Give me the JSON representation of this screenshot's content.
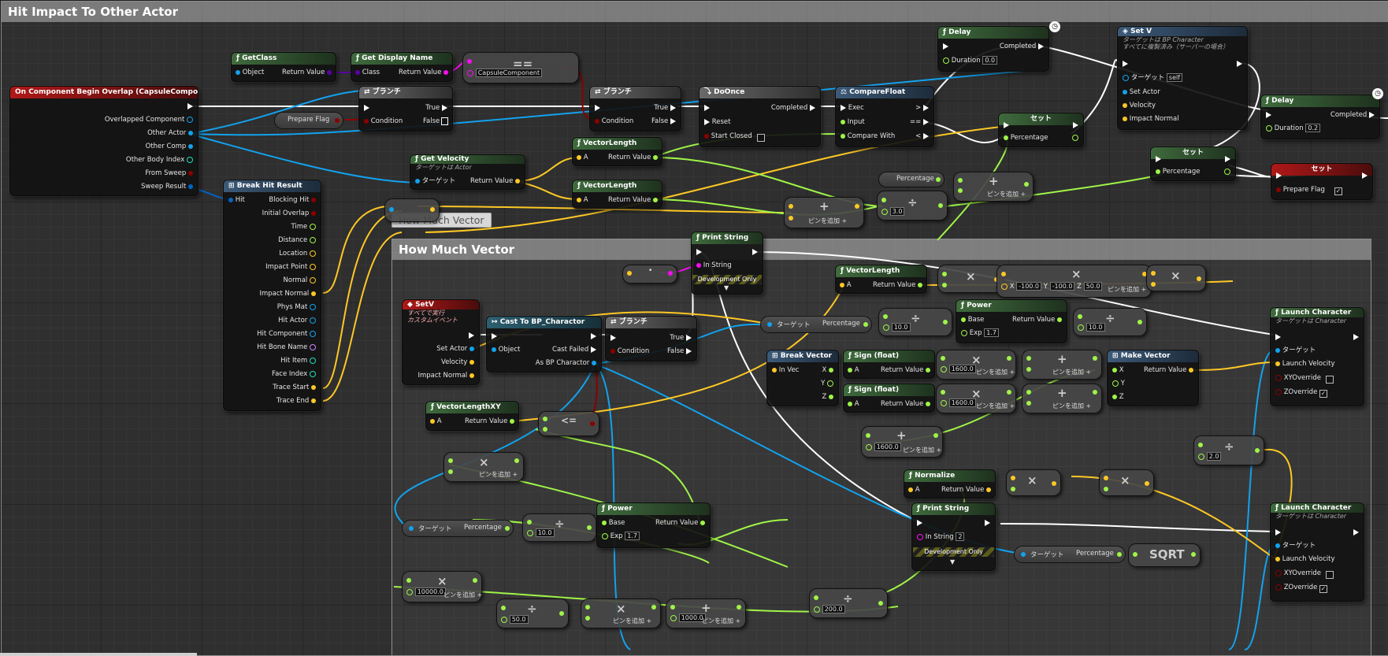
{
  "comment_main": "Hit Impact To Other Actor",
  "comment_sub": "How Much Vector",
  "comment_bubble": "How Much Vector",
  "event": {
    "title": "On Component Begin Overlap (CapsuleComponent)",
    "pins": [
      "Overlapped Component",
      "Other Actor",
      "Other Comp",
      "Other Body Index",
      "From Sweep",
      "Sweep Result"
    ]
  },
  "get_class": {
    "title": "GetClass",
    "in": "Object",
    "out": "Return Value"
  },
  "get_display_name": {
    "title": "Get Display Name",
    "in": "Class",
    "out": "Return Value"
  },
  "equal_node": {
    "op": "==",
    "value": "CapsuleComponent"
  },
  "prepare_flag_get": "Prepare Flag",
  "branch_label": "ブランチ",
  "branch_pins": {
    "true": "True",
    "false": "False",
    "condition": "Condition"
  },
  "do_once": {
    "title": "DoOnce",
    "completed": "Completed",
    "reset": "Reset",
    "start_closed": "Start Closed"
  },
  "compare_float": {
    "title": "CompareFloat",
    "exec": "Exec",
    "input": "Input",
    "compare_with": "Compare With",
    "gt": ">",
    "eq": "==",
    "lt": "<"
  },
  "delay": {
    "title": "Delay",
    "completed": "Completed",
    "duration": "Duration",
    "dur1": "0.0",
    "dur2": "0.2"
  },
  "set_v": {
    "title": "Set V",
    "subtitle": "ターゲットは BP Character",
    "subtitle2": "すべてに複製済み（サーバーの場合）",
    "target": "ターゲット",
    "target_value": "self",
    "pins": [
      "Set Actor",
      "Velocity",
      "Impact Normal"
    ]
  },
  "set_label": "セット",
  "percentage": "Percentage",
  "prepare_flag_set": "Prepare Flag",
  "add_pin": "ピンを追加",
  "target_label": "ターゲット",
  "get_velocity": {
    "title": "Get Velocity",
    "subtitle": "ターゲットは Actor",
    "out": "Return Value"
  },
  "vector_length": {
    "title": "VectorLength",
    "a": "A",
    "out": "Return Value"
  },
  "vector_length_xy": {
    "title": "VectorLengthXY",
    "a": "A",
    "out": "Return Value"
  },
  "break_hit": {
    "title": "Break Hit Result",
    "hit": "Hit",
    "pins": [
      "Blocking Hit",
      "Initial Overlap",
      "Time",
      "Distance",
      "Location",
      "Impact Point",
      "Normal",
      "Impact Normal",
      "Phys Mat",
      "Hit Actor",
      "Hit Component",
      "Hit Bone Name",
      "Hit Item",
      "Face Index",
      "Trace Start",
      "Trace End"
    ]
  },
  "values": {
    "three": "3.0",
    "ten": "10.0",
    "two": "2.0",
    "fifty": "50.0",
    "two_hundred": "200.0",
    "sixteen_hundred": "1600.0",
    "ten_thousand": "10000.0",
    "thousand": "1000.0",
    "exp": "1.7",
    "neg100": "-100.0",
    "fifty_z": "50.0",
    "x": "X",
    "y": "Y",
    "z": "Z",
    "in_string_2": "2"
  },
  "print_string": {
    "title": "Print String",
    "in": "In String",
    "dev": "Development Only"
  },
  "set_v_event": {
    "title": "SetV",
    "subtitle": "すべてで実行",
    "subtitle2": "カスタムイベント",
    "pins": [
      "Set Actor",
      "Velocity",
      "Impact Normal"
    ]
  },
  "cast": {
    "title": "Cast To BP_Charactor",
    "object": "Object",
    "failed": "Cast Failed",
    "as": "As BP Charactor"
  },
  "power": {
    "title": "Power",
    "base": "Base",
    "exp": "Exp",
    "out": "Return Value"
  },
  "break_vector": {
    "title": "Break Vector",
    "in": "In Vec",
    "x": "X",
    "y": "Y",
    "z": "Z"
  },
  "sign": {
    "title": "Sign (float)",
    "a": "A",
    "out": "Return Value"
  },
  "make_vector": {
    "title": "Make Vector",
    "x": "X",
    "y": "Y",
    "z": "Z",
    "out": "Return Value"
  },
  "normalize": {
    "title": "Normalize",
    "a": "A",
    "out": "Return Value"
  },
  "launch": {
    "title": "Launch Character",
    "subtitle": "ターゲットは Character",
    "target": "ターゲット",
    "lv": "Launch Velocity",
    "xy": "XYOverride",
    "zo": "ZOverride"
  },
  "leq": "<=",
  "sqrt": "SQRT",
  "colors": {
    "exec": "#ffffff",
    "bool": "#8c0000",
    "float": "#9ff448",
    "vector": "#fdc825",
    "object": "#12a2ee",
    "class": "#5a00a8",
    "string": "#f80cf3",
    "struct": "#0065c5"
  }
}
